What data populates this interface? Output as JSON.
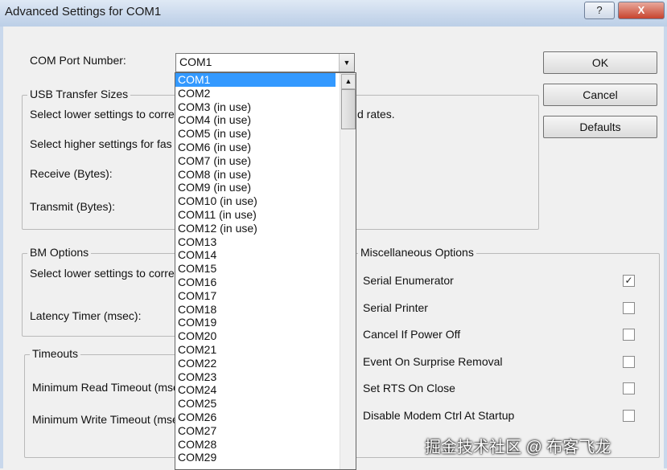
{
  "window": {
    "title": "Advanced Settings for COM1",
    "help_glyph": "?",
    "close_glyph": "X"
  },
  "com_port": {
    "label": "COM Port Number:",
    "selected": "COM1",
    "options": [
      "COM1",
      "COM2",
      "COM3 (in use)",
      "COM4 (in use)",
      "COM5 (in use)",
      "COM6 (in use)",
      "COM7 (in use)",
      "COM8 (in use)",
      "COM9 (in use)",
      "COM10 (in use)",
      "COM11 (in use)",
      "COM12 (in use)",
      "COM13",
      "COM14",
      "COM15",
      "COM16",
      "COM17",
      "COM18",
      "COM19",
      "COM20",
      "COM21",
      "COM22",
      "COM23",
      "COM24",
      "COM25",
      "COM26",
      "COM27",
      "COM28",
      "COM29"
    ]
  },
  "buttons": {
    "ok": "OK",
    "cancel": "Cancel",
    "defaults": "Defaults"
  },
  "usb": {
    "title": "USB Transfer Sizes",
    "line1_left": "Select lower settings to corre",
    "line1_right": "d rates.",
    "line2": "Select higher settings for fas",
    "receive": "Receive (Bytes):",
    "transmit": "Transmit (Bytes):"
  },
  "bm": {
    "title": "BM Options",
    "line1": "Select lower settings to corre",
    "latency": "Latency Timer (msec):"
  },
  "timeouts": {
    "title": "Timeouts",
    "read": "Minimum Read Timeout (msec",
    "write": "Minimum Write Timeout (mse"
  },
  "misc": {
    "title": "Miscellaneous Options",
    "items": [
      {
        "label": "Serial Enumerator",
        "checked": true
      },
      {
        "label": "Serial Printer",
        "checked": false
      },
      {
        "label": "Cancel If Power Off",
        "checked": false
      },
      {
        "label": "Event On Surprise Removal",
        "checked": false
      },
      {
        "label": "Set RTS On Close",
        "checked": false
      },
      {
        "label": "Disable Modem Ctrl At Startup",
        "checked": false
      }
    ]
  },
  "watermark": "掘金技术社区 @ 布客飞龙",
  "colors": {
    "selection": "#3399ff",
    "titlebar": "#c9d8ec"
  }
}
